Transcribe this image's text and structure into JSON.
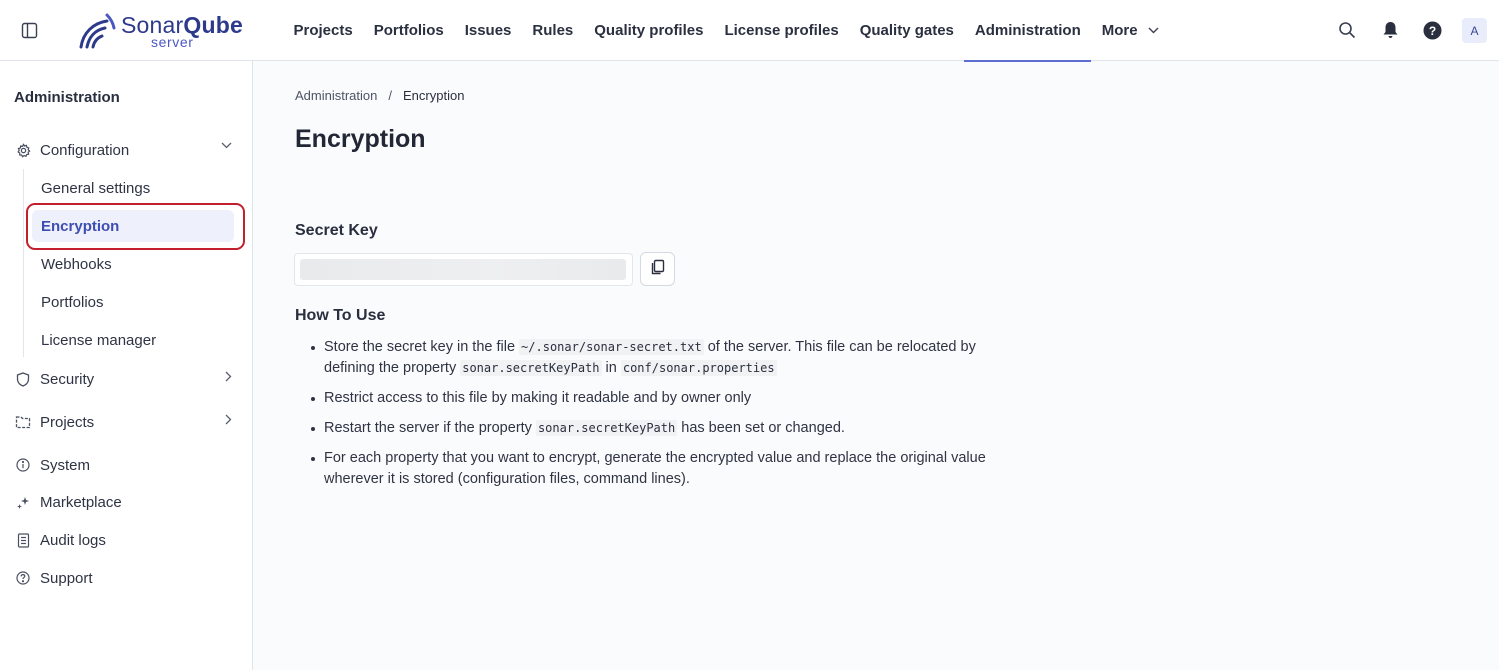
{
  "header": {
    "logo": {
      "brand_light": "Sonar",
      "brand_bold": "Qube",
      "sub": "server"
    },
    "nav": [
      {
        "label": "Projects",
        "active": false
      },
      {
        "label": "Portfolios",
        "active": false
      },
      {
        "label": "Issues",
        "active": false
      },
      {
        "label": "Rules",
        "active": false
      },
      {
        "label": "Quality profiles",
        "active": false
      },
      {
        "label": "License profiles",
        "active": false
      },
      {
        "label": "Quality gates",
        "active": false
      },
      {
        "label": "Administration",
        "active": true
      },
      {
        "label": "More",
        "active": false
      }
    ],
    "icons": [
      "search-icon",
      "bell-icon",
      "help-icon"
    ],
    "avatar": "A"
  },
  "sidebar": {
    "title": "Administration",
    "configuration": {
      "label": "Configuration",
      "expanded": true,
      "sub_items": [
        {
          "label": "General settings",
          "active": false
        },
        {
          "label": "Encryption",
          "active": true
        },
        {
          "label": "Webhooks",
          "active": false
        },
        {
          "label": "Portfolios",
          "active": false
        },
        {
          "label": "License manager",
          "active": false
        }
      ]
    },
    "items": [
      {
        "label": "Security",
        "icon": "shield-icon",
        "has_chevron": true
      },
      {
        "label": "Projects",
        "icon": "folder-icon",
        "has_chevron": true
      },
      {
        "label": "System",
        "icon": "info-icon",
        "has_chevron": false
      },
      {
        "label": "Marketplace",
        "icon": "sparkle-icon",
        "has_chevron": false
      },
      {
        "label": "Audit logs",
        "icon": "document-icon",
        "has_chevron": false
      },
      {
        "label": "Support",
        "icon": "help-circle-icon",
        "has_chevron": false
      }
    ]
  },
  "main": {
    "breadcrumb": {
      "parent": "Administration",
      "separator": "/",
      "current": "Encryption"
    },
    "title": "Encryption",
    "secret_key": {
      "label": "Secret Key",
      "value": ""
    },
    "how_to_use": {
      "title": "How To Use",
      "items": [
        {
          "p1": "Store the secret key in the file ",
          "c1": "~/.sonar/sonar-secret.txt",
          "p2": " of the server. This file can be relocated by defining the property ",
          "c2": "sonar.secretKeyPath",
          "p3": " in ",
          "c3": "conf/sonar.properties",
          "p4": ""
        },
        {
          "p1": "Restrict access to this file by making it readable and by owner only"
        },
        {
          "p1": "Restart the server if the property ",
          "c1": "sonar.secretKeyPath",
          "p2": " has been set or changed."
        },
        {
          "p1": "For each property that you want to encrypt, generate the encrypted value and replace the original value wherever it is stored (configuration files, command lines)."
        }
      ]
    }
  },
  "colors": {
    "accent": "#5d6cd0",
    "active_bg": "#eef0fb",
    "active_text": "#3e4db1",
    "highlight_border": "#c41f2e"
  }
}
